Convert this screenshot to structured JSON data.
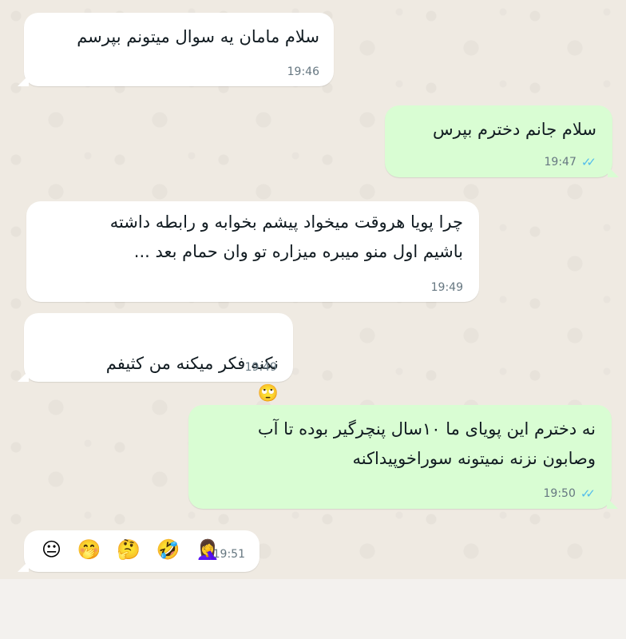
{
  "messages": [
    {
      "id": "m1",
      "direction": "incoming",
      "text": "سلام مامان یه سوال میتونم بپرسم",
      "time": "19:46"
    },
    {
      "id": "m2",
      "direction": "outgoing",
      "text": "سلام جانم دخترم بپرس",
      "time": "19:47",
      "status": "read"
    },
    {
      "id": "m3",
      "direction": "incoming",
      "text": "چرا پویا هروقت میخواد پیشم بخوابه و رابطه داشته\nباشیم اول منو میبره میزاره تو وان حمام بعد ...",
      "time": "19:49"
    },
    {
      "id": "m4",
      "direction": "incoming",
      "text": "نکنه فکر میکنه من کثیفم",
      "emoji": "🙄",
      "time": "19:49"
    },
    {
      "id": "m5",
      "direction": "outgoing",
      "text": "نه دخترم این پویای ما ۱۰سال پنچرگیر بوده تا آب\nوصابون نزنه نمیتونه سوراخوپیداکنه",
      "time": "19:50",
      "status": "read"
    },
    {
      "id": "m6",
      "direction": "incoming",
      "emojis": [
        "😐",
        "🤭",
        "🤔",
        "🤣",
        "🤦‍♀️"
      ],
      "time": "19:51"
    }
  ],
  "icons": {
    "read_receipt": "double-check-icon",
    "eye_roll": "eye-roll-emoji"
  },
  "colors": {
    "incoming": "#ffffff",
    "outgoing": "#d9fdd3",
    "read_tick": "#53bdeb",
    "background": "#efeae2"
  }
}
